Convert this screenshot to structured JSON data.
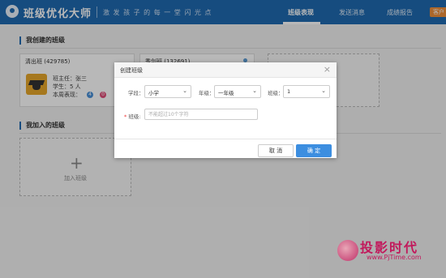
{
  "header": {
    "app_title": "班级优化大师",
    "slogan": "激 发 孩 子 的 每 一 堂 闪 光 点",
    "nav": [
      "班级表现",
      "发送消息",
      "成绩报告"
    ],
    "active_nav": "班级表现",
    "customer_label": "客户",
    "colors": {
      "bar": "#1f6ab0",
      "accent": "#ef8f3b"
    }
  },
  "main": {
    "created_section": "我创建的班级",
    "joined_section": "我加入的班级",
    "cards": [
      {
        "name": "清出班 (429785)",
        "teacher": "班主任：张三",
        "students": "学生：5 人",
        "weekly": "本周表现：",
        "badge_blue": "4",
        "badge_pink": "0"
      },
      {
        "name": "秀剑班 (132691)"
      }
    ],
    "add_class_label": "加入班级"
  },
  "dialog": {
    "title": "创建班级",
    "close_symbol": "×",
    "stage_label": "学段：",
    "stage_value": "小学",
    "grade_label": "年级：",
    "grade_value": "一年级",
    "class_label": "班级：",
    "class_value": "1",
    "required_mark": "*",
    "name_label": " 班级:",
    "name_placeholder": "不能超过10个字符",
    "cancel_label": "取 消",
    "ok_label": "确 定"
  },
  "watermark": {
    "text": "投影时代",
    "url": "www.PjTime.com"
  }
}
